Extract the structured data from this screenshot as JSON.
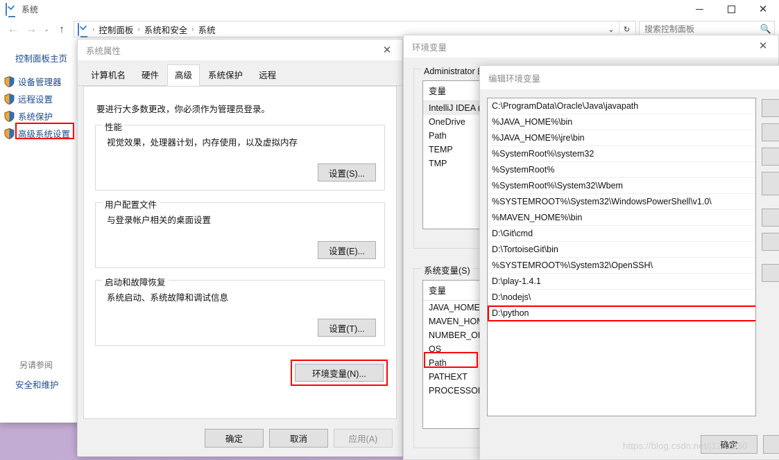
{
  "window": {
    "title": "系统",
    "icon": "monitor-icon",
    "minimize_label": "最小化",
    "maximize_label": "最大化",
    "close_label": "关闭"
  },
  "nav": {
    "back": "←",
    "forward": "→",
    "recent": "⌄",
    "up": "↑",
    "breadcrumbs": [
      "控制面板",
      "系统和安全",
      "系统"
    ],
    "separator": "›",
    "dropdown": "⌄",
    "refresh": "↻"
  },
  "search": {
    "placeholder": "搜索控制面板",
    "icon": "search-icon"
  },
  "sidebar": {
    "home": "控制面板主页",
    "items": [
      {
        "label": "设备管理器",
        "icon": "shield-icon",
        "highlighted": false
      },
      {
        "label": "远程设置",
        "icon": "shield-icon",
        "highlighted": false
      },
      {
        "label": "系统保护",
        "icon": "shield-icon",
        "highlighted": false
      },
      {
        "label": "高级系统设置",
        "icon": "shield-icon",
        "highlighted": true
      }
    ],
    "see_also_title": "另请参阅",
    "see_also_link": "安全和维护"
  },
  "system_properties": {
    "title": "系统属性",
    "close": "✕",
    "tabs": [
      {
        "label": "计算机名",
        "active": false
      },
      {
        "label": "硬件",
        "active": false
      },
      {
        "label": "高级",
        "active": true
      },
      {
        "label": "系统保护",
        "active": false
      },
      {
        "label": "远程",
        "active": false
      }
    ],
    "admin_note": "要进行大多数更改，你必须作为管理员登录。",
    "groups": [
      {
        "legend": "性能",
        "description": "视觉效果，处理器计划，内存使用，以及虚拟内存",
        "button": "设置(S)..."
      },
      {
        "legend": "用户配置文件",
        "description": "与登录帐户相关的桌面设置",
        "button": "设置(E)..."
      },
      {
        "legend": "启动和故障恢复",
        "description": "系统启动、系统故障和调试信息",
        "button": "设置(T)..."
      }
    ],
    "env_button": "环境变量(N)...",
    "footer_buttons": [
      {
        "label": "确定",
        "disabled": false
      },
      {
        "label": "取消",
        "disabled": false
      },
      {
        "label": "应用(A)",
        "disabled": true
      }
    ]
  },
  "env_vars_dialog": {
    "title": "环境变量",
    "close": "✕",
    "user_group_legend": "Administrator 的",
    "user_column_header": "变量",
    "user_variables": [
      {
        "name": "IntelliJ IDEA (",
        "selected": true
      },
      {
        "name": "OneDrive",
        "selected": false
      },
      {
        "name": "Path",
        "selected": false
      },
      {
        "name": "TEMP",
        "selected": false
      },
      {
        "name": "TMP",
        "selected": false
      }
    ],
    "system_group_legend": "系统变量(S)",
    "system_column_header": "变量",
    "system_variables": [
      {
        "name": "JAVA_HOME",
        "highlighted": false
      },
      {
        "name": "MAVEN_HOM",
        "highlighted": false
      },
      {
        "name": "NUMBER_OF_",
        "highlighted": false
      },
      {
        "name": "OS",
        "highlighted": false
      },
      {
        "name": "Path",
        "highlighted": true
      },
      {
        "name": "PATHEXT",
        "highlighted": false
      },
      {
        "name": "PROCESSOR_",
        "highlighted": false
      }
    ]
  },
  "edit_env_dialog": {
    "title": "编辑环境变量",
    "close": "✕",
    "path_entries": [
      {
        "value": "C:\\ProgramData\\Oracle\\Java\\javapath",
        "highlighted": false
      },
      {
        "value": "%JAVA_HOME%\\bin",
        "highlighted": false
      },
      {
        "value": "%JAVA_HOME%\\jre\\bin",
        "highlighted": false
      },
      {
        "value": "%SystemRoot%\\system32",
        "highlighted": false
      },
      {
        "value": "%SystemRoot%",
        "highlighted": false
      },
      {
        "value": "%SystemRoot%\\System32\\Wbem",
        "highlighted": false
      },
      {
        "value": "%SYSTEMROOT%\\System32\\WindowsPowerShell\\v1.0\\",
        "highlighted": false
      },
      {
        "value": "%MAVEN_HOME%\\bin",
        "highlighted": false
      },
      {
        "value": "D:\\Git\\cmd",
        "highlighted": false
      },
      {
        "value": "D:\\TortoiseGit\\bin",
        "highlighted": false
      },
      {
        "value": "%SYSTEMROOT%\\System32\\OpenSSH\\",
        "highlighted": false
      },
      {
        "value": "D:\\play-1.4.1",
        "highlighted": false
      },
      {
        "value": "D:\\nodejs\\",
        "highlighted": false
      },
      {
        "value": "D:\\python",
        "highlighted": true
      }
    ],
    "side_buttons": [
      "",
      "",
      "",
      "",
      "",
      "",
      ""
    ],
    "ok_label": "确定"
  },
  "watermark": "https://blog.csdn.net/j1231230",
  "colors": {
    "accent_blue": "#1b4b8f",
    "highlight_red": "#ff0000",
    "dialog_bg": "#f0f0f0",
    "desktop": "#bfa8d0"
  }
}
